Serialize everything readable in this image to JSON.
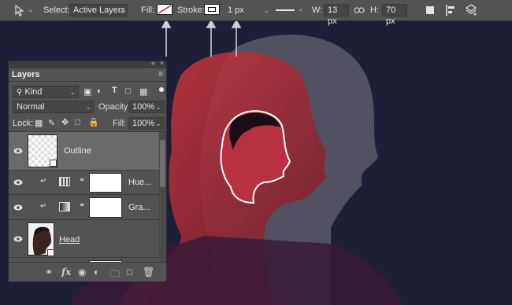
{
  "options_bar": {
    "select_label": "Select:",
    "select_value": "Active Layers",
    "fill_label": "Fill:",
    "stroke_label": "Stroke:",
    "stroke_width": "1 px",
    "w_label": "W:",
    "w_value": "13 px",
    "h_label": "H:",
    "h_value": "70 px"
  },
  "layers_panel": {
    "tab": "Layers",
    "filter_value": "Kind",
    "blend_mode": "Normal",
    "opacity_label": "Opacity:",
    "opacity_value": "100%",
    "lock_label": "Lock:",
    "fill_label": "Fill:",
    "fill_value": "100%",
    "layers": [
      {
        "name": "Outline",
        "selected": true
      },
      {
        "name": "Hue...",
        "selected": false
      },
      {
        "name": "Gra...",
        "selected": false
      },
      {
        "name": "Head",
        "selected": false
      }
    ],
    "footer_fx": "fx"
  },
  "colors": {
    "canvas_bg": "#1c1f36",
    "accent_red": "#c42b34",
    "panel_bg": "#535353"
  }
}
